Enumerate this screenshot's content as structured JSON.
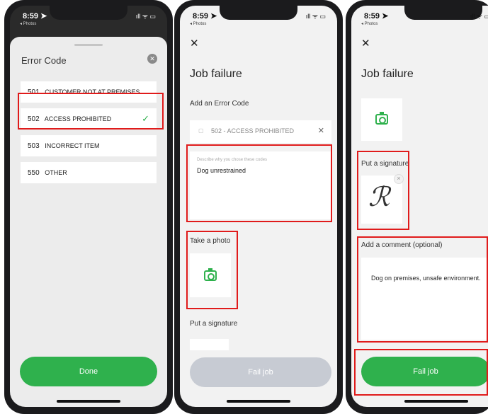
{
  "status": {
    "time": "8:59 ➤",
    "back": "◂ Photos",
    "signal": "ıll ᯤ ▭"
  },
  "screen1": {
    "title": "Error Code",
    "close_icon": "close-icon",
    "items": [
      {
        "code": "501",
        "label": "CUSTOMER NOT AT PREMISES"
      },
      {
        "code": "502",
        "label": "ACCESS PROHIBITED"
      },
      {
        "code": "503",
        "label": "INCORRECT ITEM"
      },
      {
        "code": "550",
        "label": "OTHER"
      }
    ],
    "selected_check": "✓",
    "done_label": "Done"
  },
  "screen2": {
    "close": "✕",
    "title": "Job failure",
    "error_label": "Add an Error Code",
    "error_value": "502 - ACCESS PROHIBITED",
    "error_clear": "✕",
    "reason_placeholder": "Describe why you chose these codes",
    "reason_value": "Dog unrestrained",
    "photo_label": "Take a photo",
    "signature_label": "Put a signature",
    "fail_button": "Fail job"
  },
  "screen3": {
    "close": "✕",
    "title": "Job failure",
    "signature_label": "Put a signature",
    "signature_glyph": "ℛ",
    "remove": "×",
    "comment_label": "Add a comment (optional)",
    "comment_value": "Dog on premises, unsafe environment.",
    "fail_button": "Fail job"
  },
  "colors": {
    "accent": "#2fb14d",
    "highlight": "#e01b1b",
    "disabled": "#c7cbd3"
  }
}
